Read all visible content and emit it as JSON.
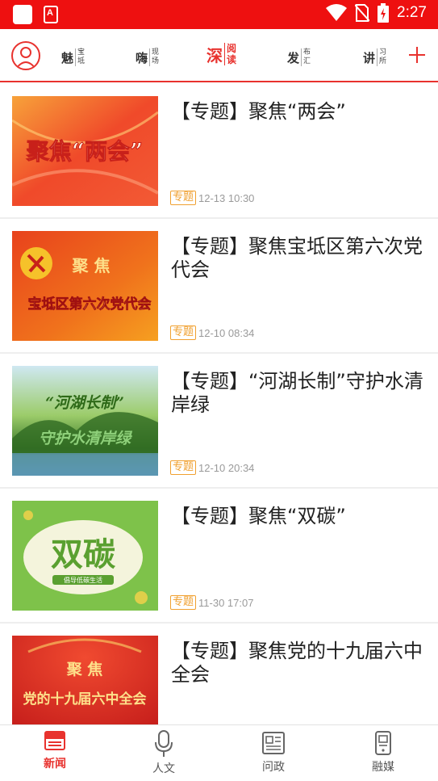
{
  "status_bar": {
    "time": "2:27",
    "app_icon_letter": "A"
  },
  "top_nav": {
    "tabs": [
      {
        "big": "魅",
        "small1": "宝",
        "small2": "坻",
        "active": false
      },
      {
        "big": "嗨",
        "small1": "现",
        "small2": "场",
        "active": false
      },
      {
        "big": "深",
        "small1": "阅",
        "small2": "读",
        "active": true
      },
      {
        "big": "发",
        "small1": "布",
        "small2": "汇",
        "active": false
      },
      {
        "big": "讲",
        "small1": "习",
        "small2": "所",
        "active": false
      }
    ]
  },
  "articles": [
    {
      "title": "【专题】聚焦“两会”",
      "tag": "专题",
      "time": "12-13 10:30",
      "thumb_text": [
        "聚焦“两会”"
      ]
    },
    {
      "title": "【专题】聚焦宝坻区第六次党代会",
      "tag": "专题",
      "time": "12-10 08:34",
      "thumb_text": [
        "聚  焦",
        "宝坻区第六次党代会"
      ]
    },
    {
      "title": "【专题】“河湖长制”守护水清岸绿",
      "tag": "专题",
      "time": "12-10 20:34",
      "thumb_text": [
        "“河湖长制”",
        "守护水清岸绿"
      ]
    },
    {
      "title": "【专题】聚焦“双碳”",
      "tag": "专题",
      "time": "11-30 17:07",
      "thumb_text": [
        "双碳",
        "倡导低碳生活"
      ]
    },
    {
      "title": "【专题】聚焦党的十九届六中全会",
      "tag": "",
      "time": "",
      "thumb_text": [
        "聚  焦",
        "党的十九届六中全会"
      ]
    }
  ],
  "bottom_tabs": [
    {
      "label": "新闻",
      "icon": "news-icon",
      "active": true
    },
    {
      "label": "人文",
      "icon": "microphone-icon",
      "active": false
    },
    {
      "label": "问政",
      "icon": "newspaper-icon",
      "active": false
    },
    {
      "label": "融媒",
      "icon": "media-icon",
      "active": false
    }
  ],
  "colors": {
    "brand_red": "#e8322e",
    "status_red": "#ee1010",
    "tag_orange": "#f0a030"
  }
}
